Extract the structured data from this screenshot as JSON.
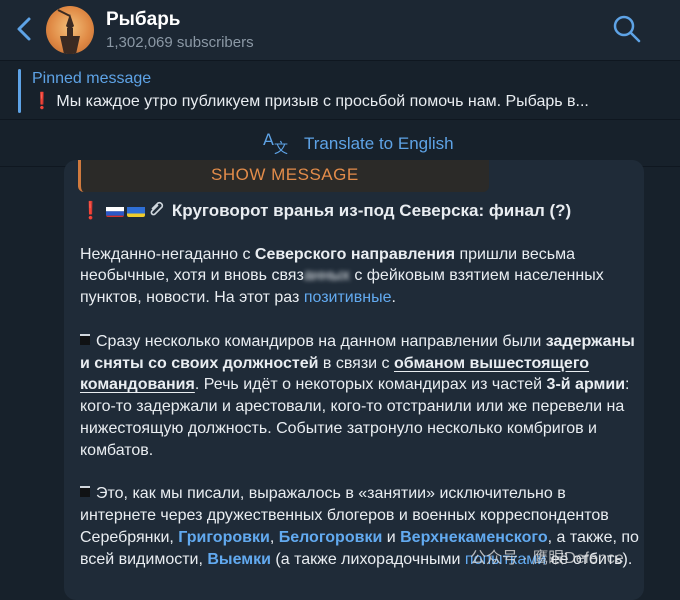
{
  "header": {
    "channel_name": "Рыбарь",
    "subscribers": "1,302,069 subscribers",
    "back_icon": "chevron-left-icon",
    "search_icon": "search-icon"
  },
  "pinned": {
    "label": "Pinned message",
    "text": "Мы каждое утро публикуем призыв с просьбой помочь нам.   Рыбарь в..."
  },
  "translate": {
    "label": "Translate to English"
  },
  "message": {
    "show_message": "SHOW MESSAGE",
    "title": "Круговорот вранья из-под Северска: финал (?)",
    "p1": {
      "t1": "Нежданно-негаданно с ",
      "b1": "Северского направления",
      "t2": " пришли весьма необычные, хотя и вновь связ",
      "t3": "с фейковым взятием населенных пунктов, новости. На этот раз ",
      "link": "позитивные",
      "t4": "."
    },
    "p2": {
      "t1": "Сразу несколько командиров на данном направлении были ",
      "b1": "задержаны и сняты со своих должностей",
      "t2": " в связи с ",
      "b2": "обманом вышестоящего командования",
      "t3": ". Речь идёт о некоторых командирах из частей ",
      "b3": "3-й армии",
      "t4": ": кого-то задержали и арестовали, кого-то отстранили или же перевели на нижестоящую должность. Событие затронуло несколько комбригов и комбатов."
    },
    "p3": {
      "t1": "Это, как мы писали, выражалось в «занятии» исключительно в интернете через дружественных блогеров и военных корреспондентов Серебрянки, ",
      "l1": "Григоровки",
      "t2": ", ",
      "l2": "Белогоровки",
      "t3": " и ",
      "l3": "Верхнекаменского",
      "t4": ", а также, по всей видимости, ",
      "l4": "Выемки",
      "t5": " (а также лихорадочными ",
      "l5": "попытками",
      "t6": " её отбить)."
    }
  },
  "watermark": "公众号 · 鹰眼Defence"
}
